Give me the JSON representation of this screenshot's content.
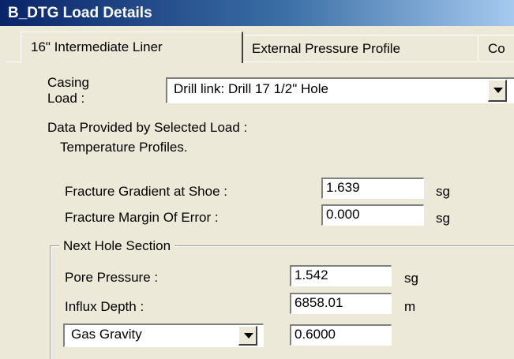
{
  "window": {
    "title": "B_DTG Load Details"
  },
  "tabs": [
    {
      "label": "16\" Intermediate Liner",
      "active": true
    },
    {
      "label": "External Pressure Profile",
      "active": false
    },
    {
      "label": "Co",
      "active": false
    }
  ],
  "casing_load": {
    "label_line1": "Casing",
    "label_line2": "Load :",
    "value": "Drill link: Drill 17 1/2\" Hole"
  },
  "data_provided": {
    "heading": "Data Provided by Selected Load :",
    "detail": "Temperature  Profiles."
  },
  "fracture_gradient": {
    "label": "Fracture Gradient at Shoe :",
    "value": "1.639",
    "unit": "sg"
  },
  "fracture_margin": {
    "label": "Fracture Margin Of Error :",
    "value": "0.000",
    "unit": "sg"
  },
  "next_hole": {
    "title": "Next Hole Section",
    "pore_pressure": {
      "label": "Pore Pressure :",
      "value": "1.542",
      "unit": "sg"
    },
    "influx_depth": {
      "label": "Influx Depth :",
      "value": "6858.01",
      "unit": "m"
    },
    "gas": {
      "selected": "Gas Gravity",
      "value": "0.6000"
    }
  },
  "icons": {
    "dropdown": "chevron-down-icon"
  }
}
